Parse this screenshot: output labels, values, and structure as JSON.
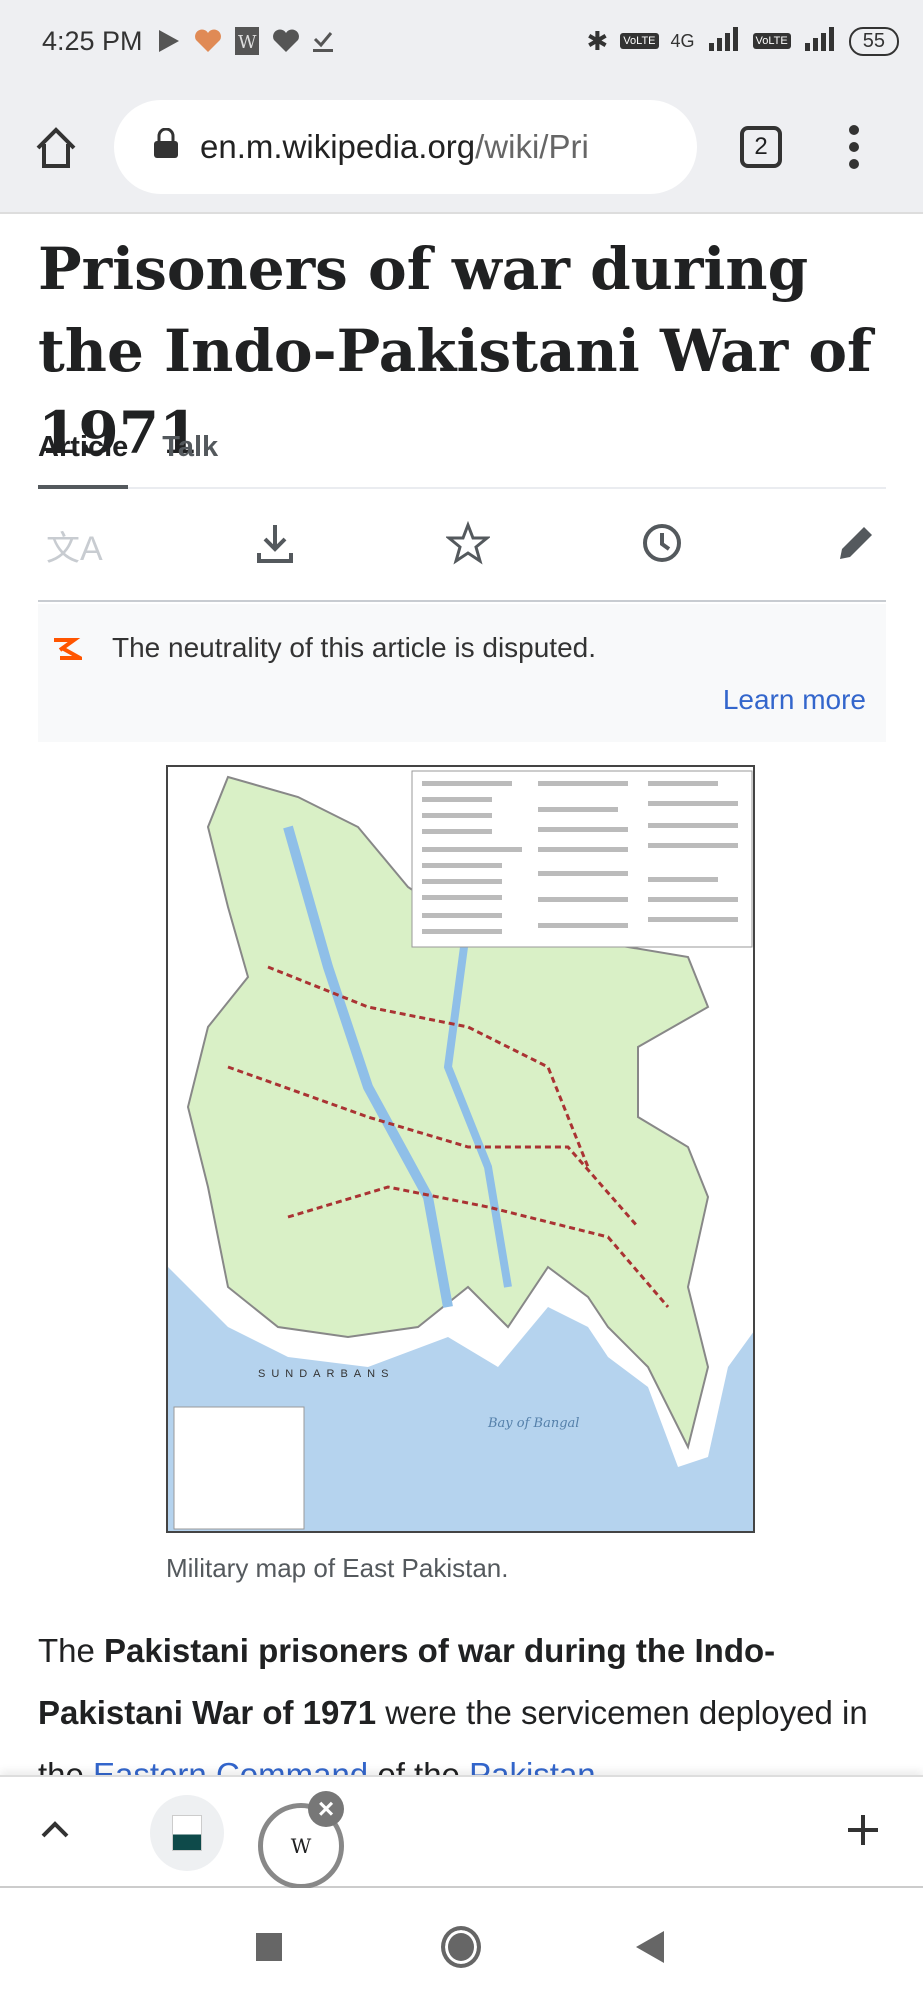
{
  "status_bar": {
    "time": "4:25 PM",
    "battery": "55",
    "network": "4G",
    "icons": [
      "play-store-icon",
      "health-heart-icon",
      "wikipedia-icon",
      "heart-check-icon",
      "download-done-icon",
      "bluetooth-icon",
      "volte-icon",
      "signal-icon"
    ]
  },
  "browser": {
    "url_host": "en.m.wikipedia.org",
    "url_path": "/wiki/Pri",
    "tab_count": "2"
  },
  "article": {
    "title": "Prisoners of war during the Indo-Pakistani War of 1971",
    "tabs": [
      {
        "label": "Article",
        "active": true
      },
      {
        "label": "Talk",
        "active": false
      }
    ],
    "toolbar": [
      "language-icon",
      "download-icon",
      "star-icon",
      "history-icon",
      "edit-icon"
    ],
    "notice": {
      "text": "The neutrality of this article is disputed.",
      "link": "Learn more"
    },
    "figure": {
      "caption": "Military map of East Pakistan.",
      "map_labels": [
        "SUNDARBANS",
        "Bay of Bangal"
      ]
    },
    "body": {
      "p1": "The ",
      "b1": "Pakistani prisoners of war during the Indo-Pakistani War of 1971",
      "p2": " were the servicemen deployed in the ",
      "link1": "Eastern Command",
      "p3": " of the ",
      "link2": "Pakistan"
    }
  },
  "tabstrip": {
    "tabs": [
      "defence-site-tab",
      "wikipedia-tab"
    ],
    "active_tab_letter": "W"
  },
  "colors": {
    "link": "#3366cc",
    "notice_icon": "#ff5500",
    "map_land": "#d9f0c6",
    "map_water": "#b5d3ee"
  }
}
